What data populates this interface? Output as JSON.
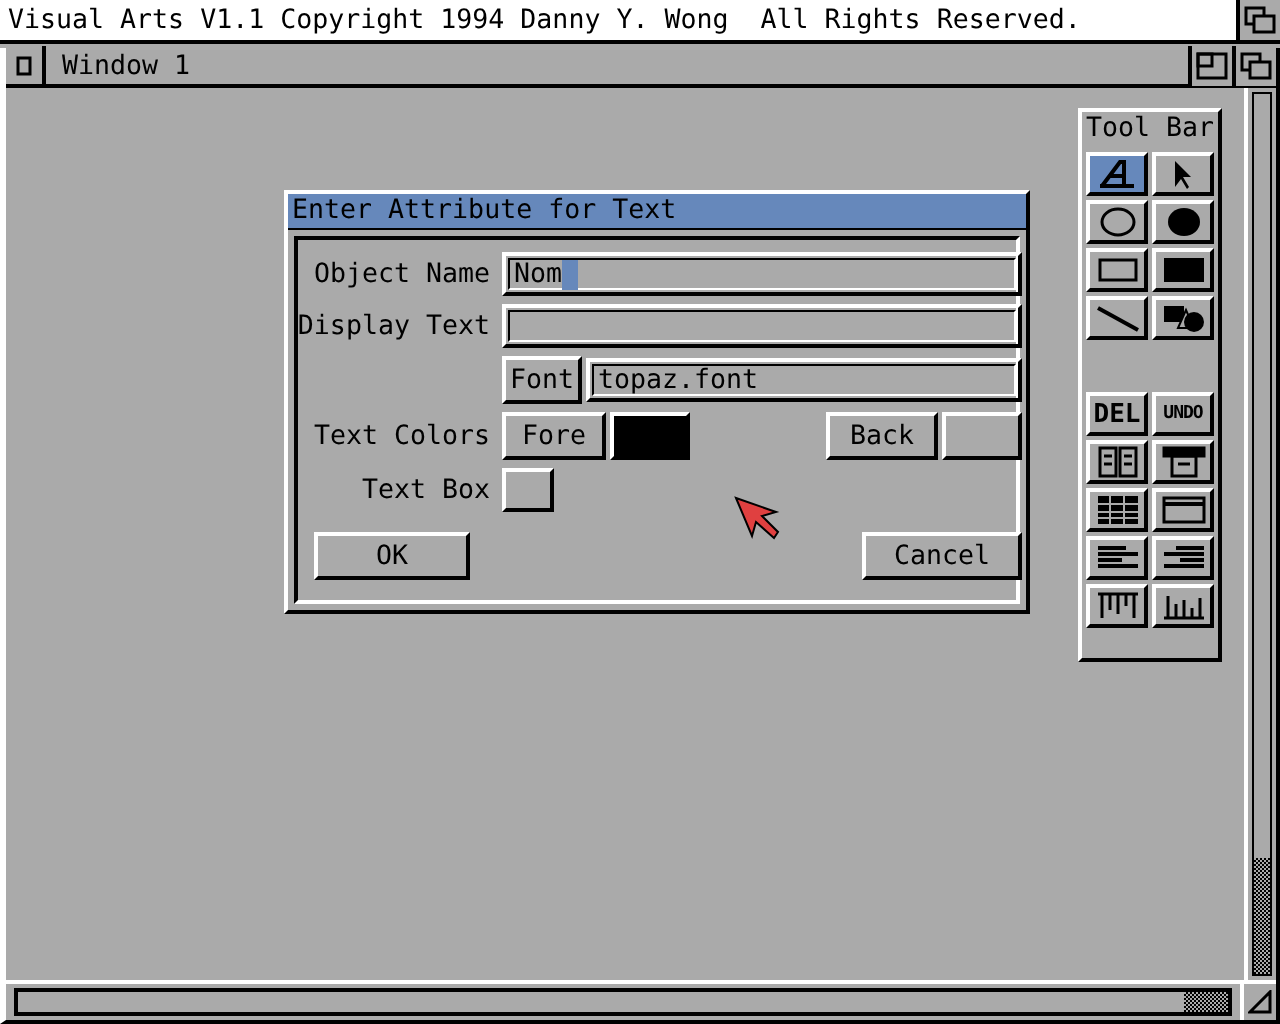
{
  "screen_title": "Visual Arts V1.1 Copyright 1994 Danny Y. Wong  All Rights Reserved.",
  "window": {
    "title": "Window 1"
  },
  "dialog": {
    "title": "Enter Attribute for Text",
    "fields": [
      {
        "label": "Object Name",
        "value": "Nom",
        "focused": true
      },
      {
        "label": "Display Text",
        "focused": false
      }
    ],
    "font": {
      "button": "Font",
      "value": "topaz.font"
    },
    "text_colors": {
      "label": "Text Colors",
      "fore": {
        "button": "Fore",
        "color": "#000000"
      },
      "back": {
        "button": "Back",
        "color": "#aaaaaa"
      }
    },
    "text_box": {
      "label": "Text Box",
      "checked": false
    },
    "buttons": [
      "OK",
      "Cancel"
    ]
  },
  "tool_bar": {
    "title": "Tool Bar",
    "groups": [
      [
        {
          "kind": "icon",
          "selected": true
        },
        {
          "kind": "icon",
          "selected": false
        },
        {
          "kind": "icon",
          "selected": false
        },
        {
          "kind": "icon",
          "selected": false
        },
        {
          "kind": "icon",
          "selected": false
        },
        {
          "kind": "icon",
          "selected": false
        },
        {
          "kind": "icon",
          "selected": false
        },
        {
          "kind": "icon",
          "selected": false
        }
      ],
      [
        {
          "kind": "text",
          "label": "DEL"
        },
        {
          "kind": "text",
          "label": "UNDO"
        },
        {
          "kind": "icon",
          "selected": false
        },
        {
          "kind": "icon",
          "selected": false
        },
        {
          "kind": "icon",
          "selected": false
        },
        {
          "kind": "icon",
          "selected": false
        },
        {
          "kind": "icon",
          "selected": false
        },
        {
          "kind": "icon",
          "selected": false
        },
        {
          "kind": "icon",
          "selected": false
        },
        {
          "kind": "icon",
          "selected": false
        }
      ]
    ]
  }
}
